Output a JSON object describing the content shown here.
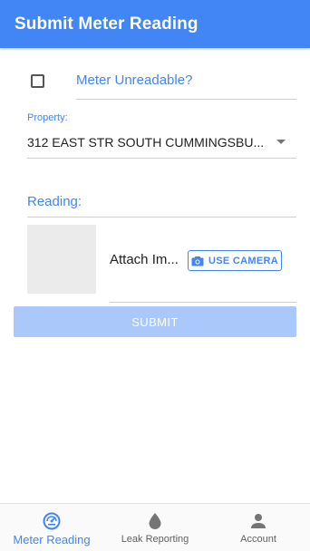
{
  "header": {
    "title": "Submit Meter Reading"
  },
  "form": {
    "unreadable_label": "Meter Unreadable?",
    "unreadable_checked": false,
    "property_label": "Property:",
    "property_value": "312 EAST STR SOUTH CUMMINGSBU...",
    "reading_label": "Reading:",
    "attach_label": "Attach Im...",
    "camera_button_label": "USE CAMERA",
    "submit_label": "SUBMIT"
  },
  "bottom_nav": {
    "items": [
      {
        "label": "Meter Reading",
        "icon": "gauge-icon",
        "active": true
      },
      {
        "label": "Leak Reporting",
        "icon": "water-drop-icon",
        "active": false
      },
      {
        "label": "Account",
        "icon": "person-icon",
        "active": false
      }
    ]
  },
  "colors": {
    "primary": "#4285f4",
    "submit_disabled": "#aac8fa",
    "nav_inactive": "#616161"
  }
}
